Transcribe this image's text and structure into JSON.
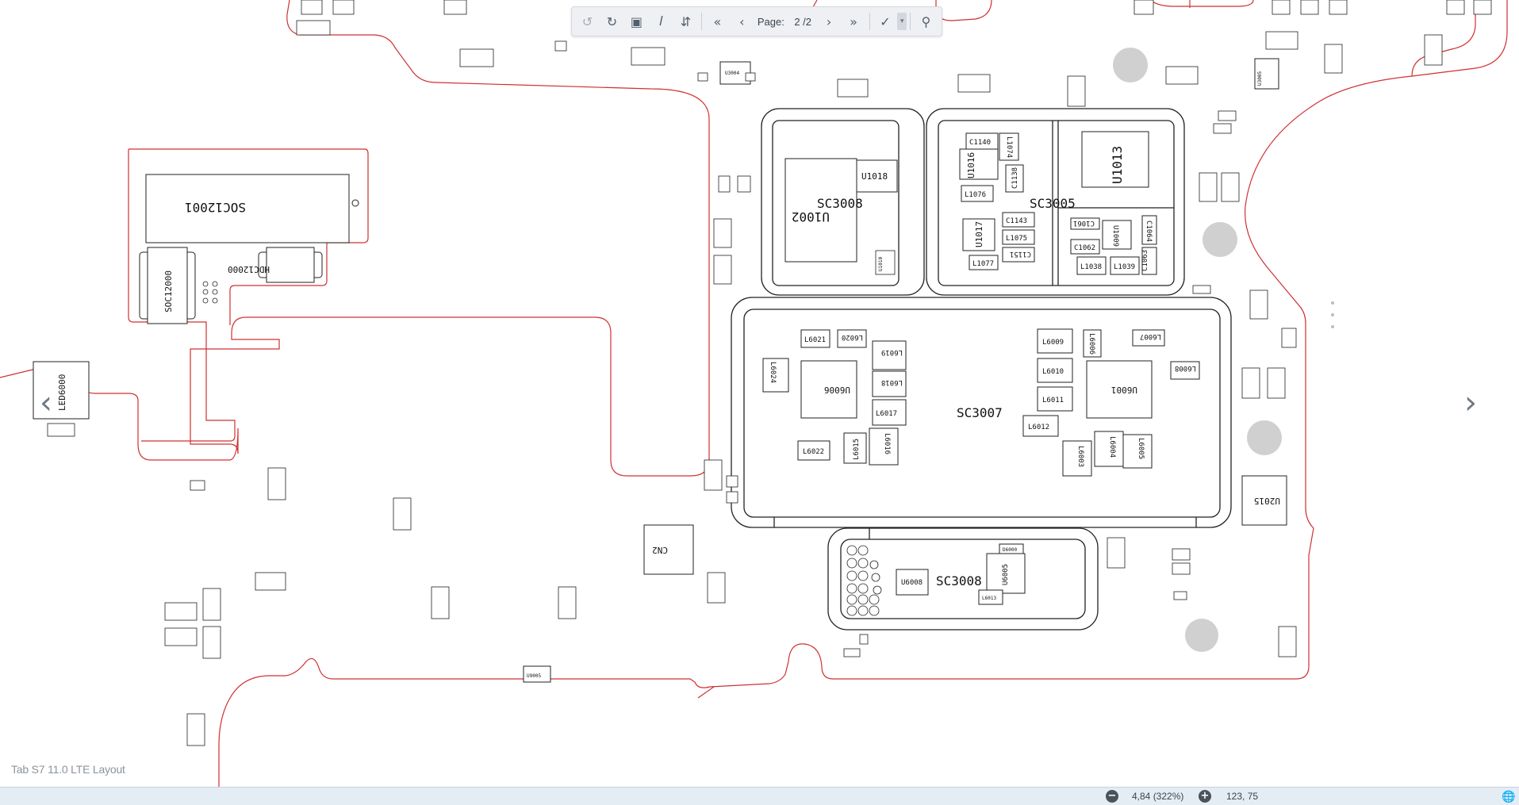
{
  "document": {
    "title": "Tab S7 11.0 LTE Layout"
  },
  "toolbar": {
    "page_label": "Page:",
    "page_value": "2 /2",
    "icons": [
      "rotate-ccw-icon",
      "rotate-cw-icon",
      "fit-page-icon",
      "text-select-icon",
      "expand-collapse-icon",
      "first-page-icon",
      "prev-page-icon",
      "next-page-icon",
      "last-page-icon",
      "highlight-tool-icon",
      "search-icon"
    ]
  },
  "board": {
    "outline_color": "#d03030",
    "part_color": "#222222",
    "shields": [
      {
        "name": "SC3008",
        "label": "SC3008"
      },
      {
        "name": "SC3005",
        "label": "SC3005"
      },
      {
        "name": "SC3007",
        "label": "SC3007"
      },
      {
        "name": "SC3008b",
        "label": "SC3008"
      }
    ],
    "components": {
      "soc12001": "SOC12001",
      "soc12000": "SOC12000",
      "hdc12000": "HDC12000",
      "led6000": "LED6000",
      "cn2": "CN2",
      "u1018": "U1018",
      "u1002": "U1002",
      "u1016": "U1016",
      "u1017": "U1017",
      "u1013": "U1013",
      "u1009": "U1009",
      "c1140": "C1140",
      "l1074": "L1074",
      "c1143": "C1143",
      "l1075": "L1075",
      "c1151": "C1151",
      "l1077": "L1077",
      "l1076": "L1076",
      "c1138": "C1138",
      "c1061": "C1061",
      "c1062": "C1062",
      "c1064": "C1064",
      "c1063": "C1063",
      "l1038": "L1038",
      "l1039": "L1039",
      "u6006": "U6006",
      "u6001": "U6001",
      "l6021": "L6021",
      "l6020": "L6020",
      "l6019": "L6019",
      "l6018": "L6018",
      "l6017": "L6017",
      "l6024": "L6024",
      "l6022": "L6022",
      "l6015": "L6015",
      "l6016": "L6016",
      "l6009": "L6009",
      "l6010": "L6010",
      "l6011": "L6011",
      "l6012": "L6012",
      "l6006": "L6006",
      "l6007": "L6007",
      "l6008": "L6008",
      "l6003": "L6003",
      "l6004": "L6004",
      "l6005": "L6005",
      "u2015": "U2015",
      "u3004": "U3004",
      "u6008": "U6008",
      "u6005": "U6005",
      "l6013": "L6013",
      "d6000": "D6000",
      "u9005": "U9005",
      "u3005": "U3005",
      "u1010": "U1010"
    }
  },
  "status": {
    "zoom": "4,84 (322%)",
    "coordinates": "123, 75"
  }
}
